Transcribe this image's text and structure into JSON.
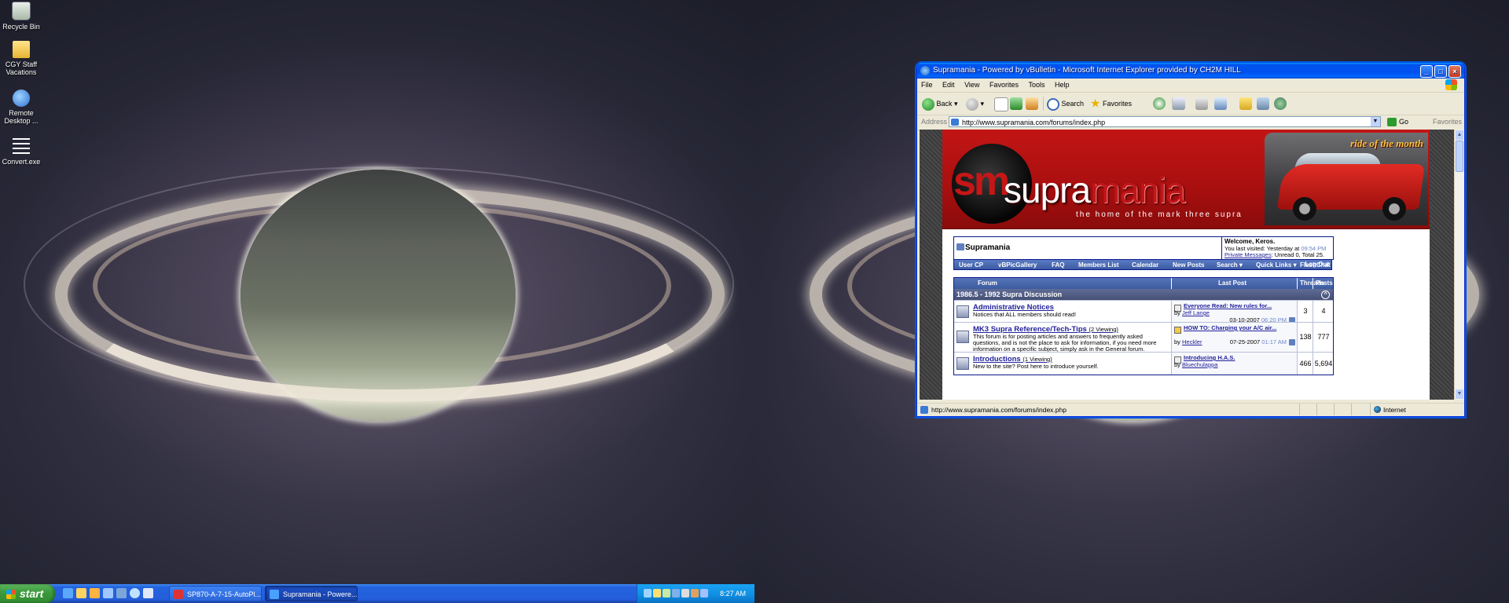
{
  "desktop": {
    "icons": [
      {
        "label": "Recycle Bin",
        "icon": "recycle-bin-icon"
      },
      {
        "label": "CGY Staff Vacations",
        "icon": "folder-icon"
      },
      {
        "label": "Remote Desktop ...",
        "icon": "remote-desktop-icon"
      },
      {
        "label": "Convert.exe",
        "icon": "exe-icon"
      }
    ]
  },
  "taskbar": {
    "start_label": "start",
    "tasks": [
      {
        "label": "SP870-A-7-15-AutoPl...",
        "icon": "pdf-icon"
      },
      {
        "label": "Supramania - Powere...",
        "icon": "ie-icon"
      }
    ],
    "clock": "8:27 AM"
  },
  "browser": {
    "title": "Supramania - Powered by vBulletin - Microsoft Internet Explorer provided by CH2M HILL",
    "menu": [
      "File",
      "Edit",
      "View",
      "Favorites",
      "Tools",
      "Help"
    ],
    "toolbar": {
      "back": "Back",
      "search": "Search",
      "favorites": "Favorites"
    },
    "address_label": "Address",
    "url": "http://www.supramania.com/forums/index.php",
    "go_label": "Go",
    "favorites_link": "Favorites",
    "status_text": "http://www.supramania.com/forums/index.php",
    "status_zone": "Internet"
  },
  "site": {
    "logo_letters": "sm",
    "logo_word_a": "supra",
    "logo_word_b": "mania",
    "tagline": "the home of the mark three supra",
    "banner_overlay": "ride of the month",
    "breadcrumb": "Supramania",
    "welcome": {
      "heading": "Welcome, Keros.",
      "last_visited_prefix": "You last visited: Yesterday at",
      "last_visited_time": "09:54 PM",
      "pm_link": "Private Messages",
      "pm_stats": ": Unread 0, Total 25."
    },
    "nav": [
      "User CP",
      "vBPicGallery",
      "FAQ",
      "Members List",
      "Calendar",
      "New Posts",
      "Search ▾",
      "Quick Links ▾",
      "FlashChat",
      "Log Out"
    ],
    "table_headers": {
      "forum": "Forum",
      "last_post": "Last Post",
      "threads": "Threads",
      "posts": "Posts"
    },
    "category": "1986.5 - 1992 Supra Discussion",
    "forums": [
      {
        "title": "Administrative Notices",
        "viewing": "",
        "description": "Notices that ALL members should read!",
        "last_post_title": "Everyone Read: New rules for...",
        "last_post_by": "Jeff Lange",
        "last_post_date": "03-10-2007",
        "last_post_time": "06:20 PM",
        "threads": "3",
        "posts": "4"
      },
      {
        "title": "MK3 Supra Reference/Tech-Tips",
        "viewing": "(2 Viewing)",
        "description": "This forum is for posting articles and answers to frequently asked questions, and is not the place to ask for information, if you need more information on a specific subject, simply ask in the General forum.",
        "last_post_title": "HOW TO: Charging your A/C air...",
        "last_post_by": "Heckler",
        "last_post_date": "07-25-2007",
        "last_post_time": "01:17 AM",
        "threads": "138",
        "posts": "777"
      },
      {
        "title": "Introductions",
        "viewing": "(1 Viewing)",
        "description": "New to the site? Post here to introduce yourself.",
        "last_post_title": "Introducing H.A.S.",
        "last_post_by": "Bluechulappa",
        "last_post_date": "",
        "last_post_time": "",
        "threads": "466",
        "posts": "5,694"
      }
    ]
  },
  "colors": {
    "xp_blue": "#245edb",
    "start_green": "#3d9c3d",
    "site_red": "#b31212",
    "forum_blue": "#3c5ba0"
  }
}
